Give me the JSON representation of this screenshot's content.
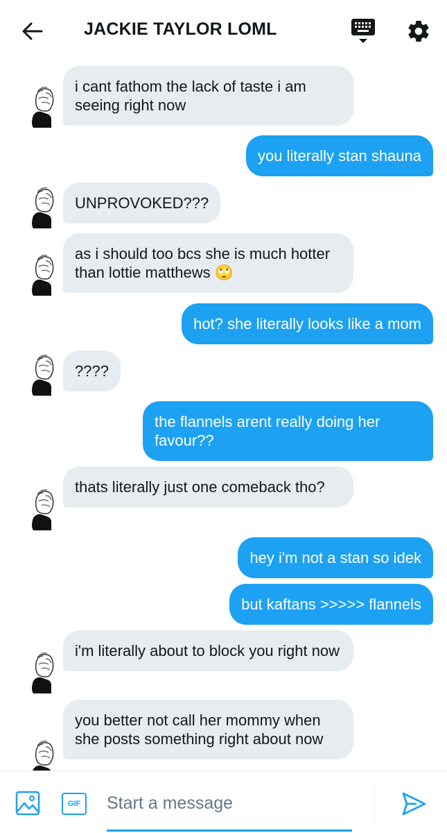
{
  "header": {
    "title": "JACKIE TAYLOR LOML",
    "icons": [
      "back-arrow-icon",
      "keyboard-icon",
      "gear-icon"
    ]
  },
  "messages": [
    {
      "from": "them",
      "text": "i cant fathom the lack of taste i am seeing right now"
    },
    {
      "from": "me",
      "text": "you literally stan shauna"
    },
    {
      "from": "them",
      "text": "UNPROVOKED???"
    },
    {
      "from": "them",
      "text": "as i should too bcs she is much hotter than lottie matthews 🙄"
    },
    {
      "from": "me",
      "text": "hot? she literally looks like a mom"
    },
    {
      "from": "them",
      "text": "????"
    },
    {
      "from": "me",
      "text": "the flannels arent really doing her favour??"
    },
    {
      "from": "them",
      "text": "thats literally just one comeback tho?"
    },
    {
      "from": "me",
      "text": "hey i'm not a stan so idek"
    },
    {
      "from": "me",
      "text": "but kaftans >>>>> flannels"
    },
    {
      "from": "them",
      "text": "i'm literally about to block you right now"
    },
    {
      "from": "them",
      "text": "you better not call her mommy when she posts something right about now"
    }
  ],
  "composer": {
    "placeholder": "Start a message",
    "gif_label": "GIF",
    "icons": [
      "image-icon",
      "gif-icon",
      "send-icon"
    ]
  },
  "colors": {
    "accent": "#1da1f2",
    "received_bubble": "#e6ecf0",
    "text": "#14171a",
    "placeholder": "#657786"
  }
}
